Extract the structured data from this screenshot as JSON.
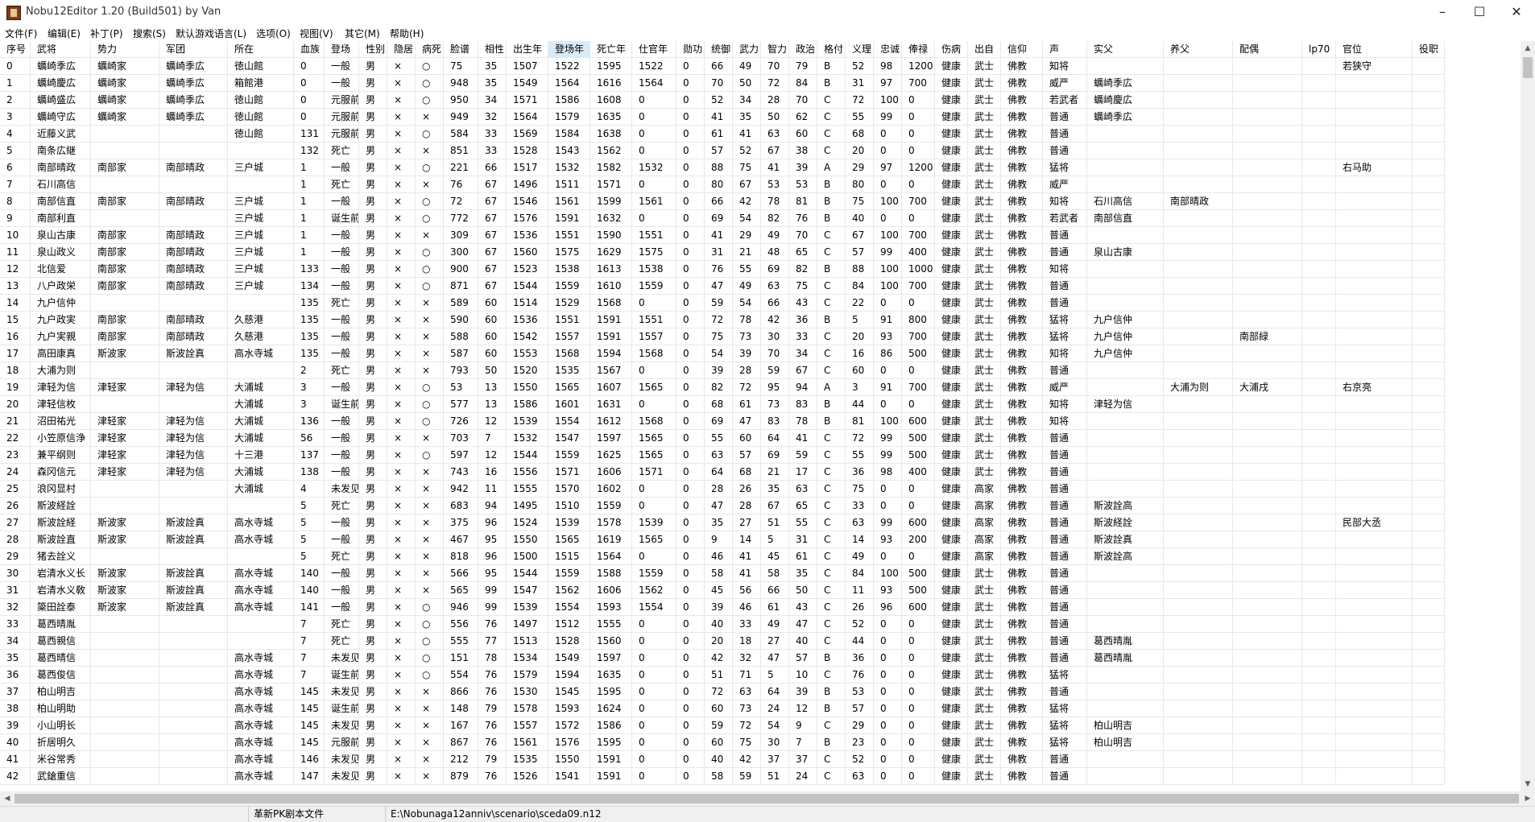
{
  "window": {
    "title": "Nobu12Editor 1.20 (Build501) by Van",
    "minimize_icon": "–",
    "maximize_icon": "☐",
    "close_icon": "✕"
  },
  "menu": [
    "文件(F)",
    "编辑(E)",
    "补丁(P)",
    "搜索(S)",
    "默认游戏语言(L)",
    "选项(O)",
    "视图(V)",
    "其它(M)",
    "帮助(H)"
  ],
  "columns": [
    "序号",
    "武将",
    "势力",
    "军团",
    "所在",
    "血族",
    "登场",
    "性别",
    "隐居",
    "病死",
    "脸谱",
    "相性",
    "出生年",
    "登场年",
    "死亡年",
    "仕官年",
    "勋功",
    "统御",
    "武力",
    "智力",
    "政治",
    "格付",
    "义理",
    "忠诚",
    "俸禄",
    "伤病",
    "出自",
    "信仰",
    "声",
    "实父",
    "养父",
    "配偶",
    "lp70",
    "官位",
    "役职"
  ],
  "sorted_column": 13,
  "rows": [
    [
      "0",
      "蠣崎季広",
      "蠣崎家",
      "蠣崎季広",
      "徳山館",
      "0",
      "一般",
      "男",
      "×",
      "○",
      "75",
      "35",
      "1507",
      "1522",
      "1595",
      "1522",
      "0",
      "66",
      "49",
      "70",
      "79",
      "B",
      "52",
      "98",
      "1200",
      "健康",
      "武士",
      "佛教",
      "知将",
      "",
      "",
      "",
      "",
      "若狭守",
      ""
    ],
    [
      "1",
      "蠣崎慶広",
      "蠣崎家",
      "蠣崎季広",
      "箱館港",
      "0",
      "一般",
      "男",
      "×",
      "○",
      "948",
      "35",
      "1549",
      "1564",
      "1616",
      "1564",
      "0",
      "70",
      "50",
      "72",
      "84",
      "B",
      "31",
      "97",
      "700",
      "健康",
      "武士",
      "佛教",
      "威严",
      "蠣崎季広",
      "",
      "",
      "",
      "",
      ""
    ],
    [
      "2",
      "蠣崎盛広",
      "蠣崎家",
      "蠣崎季広",
      "徳山館",
      "0",
      "元服前",
      "男",
      "×",
      "○",
      "950",
      "34",
      "1571",
      "1586",
      "1608",
      "0",
      "0",
      "52",
      "34",
      "28",
      "70",
      "C",
      "72",
      "100",
      "0",
      "健康",
      "武士",
      "佛教",
      "若武者",
      "蠣崎慶広",
      "",
      "",
      "",
      "",
      ""
    ],
    [
      "3",
      "蠣崎守広",
      "蠣崎家",
      "蠣崎季広",
      "徳山館",
      "0",
      "元服前",
      "男",
      "×",
      "×",
      "949",
      "32",
      "1564",
      "1579",
      "1635",
      "0",
      "0",
      "41",
      "35",
      "50",
      "62",
      "C",
      "55",
      "99",
      "0",
      "健康",
      "武士",
      "佛教",
      "普通",
      "蠣崎季広",
      "",
      "",
      "",
      "",
      ""
    ],
    [
      "4",
      "近藤义武",
      "",
      "",
      "徳山館",
      "131",
      "元服前",
      "男",
      "×",
      "○",
      "584",
      "33",
      "1569",
      "1584",
      "1638",
      "0",
      "0",
      "61",
      "41",
      "63",
      "60",
      "C",
      "68",
      "0",
      "0",
      "健康",
      "武士",
      "佛教",
      "普通",
      "",
      "",
      "",
      "",
      "",
      ""
    ],
    [
      "5",
      "南条広継",
      "",
      "",
      "",
      "132",
      "死亡",
      "男",
      "×",
      "×",
      "851",
      "33",
      "1528",
      "1543",
      "1562",
      "0",
      "0",
      "57",
      "52",
      "67",
      "38",
      "C",
      "20",
      "0",
      "0",
      "健康",
      "武士",
      "佛教",
      "普通",
      "",
      "",
      "",
      "",
      "",
      ""
    ],
    [
      "6",
      "南部晴政",
      "南部家",
      "南部晴政",
      "三户城",
      "1",
      "一般",
      "男",
      "×",
      "○",
      "221",
      "66",
      "1517",
      "1532",
      "1582",
      "1532",
      "0",
      "88",
      "75",
      "41",
      "39",
      "A",
      "29",
      "97",
      "1200",
      "健康",
      "武士",
      "佛教",
      "猛将",
      "",
      "",
      "",
      "",
      "右马助",
      ""
    ],
    [
      "7",
      "石川高信",
      "",
      "",
      "",
      "1",
      "死亡",
      "男",
      "×",
      "×",
      "76",
      "67",
      "1496",
      "1511",
      "1571",
      "0",
      "0",
      "80",
      "67",
      "53",
      "53",
      "B",
      "80",
      "0",
      "0",
      "健康",
      "武士",
      "佛教",
      "威严",
      "",
      "",
      "",
      "",
      "",
      ""
    ],
    [
      "8",
      "南部信直",
      "南部家",
      "南部晴政",
      "三户城",
      "1",
      "一般",
      "男",
      "×",
      "○",
      "72",
      "67",
      "1546",
      "1561",
      "1599",
      "1561",
      "0",
      "66",
      "42",
      "78",
      "81",
      "B",
      "75",
      "100",
      "700",
      "健康",
      "武士",
      "佛教",
      "知将",
      "石川高信",
      "南部晴政",
      "",
      "",
      "",
      ""
    ],
    [
      "9",
      "南部利直",
      "",
      "",
      "三户城",
      "1",
      "诞生前",
      "男",
      "×",
      "○",
      "772",
      "67",
      "1576",
      "1591",
      "1632",
      "0",
      "0",
      "69",
      "54",
      "82",
      "76",
      "B",
      "40",
      "0",
      "0",
      "健康",
      "武士",
      "佛教",
      "若武者",
      "南部信直",
      "",
      "",
      "",
      "",
      ""
    ],
    [
      "10",
      "泉山古康",
      "南部家",
      "南部晴政",
      "三户城",
      "1",
      "一般",
      "男",
      "×",
      "×",
      "309",
      "67",
      "1536",
      "1551",
      "1590",
      "1551",
      "0",
      "41",
      "29",
      "49",
      "70",
      "C",
      "67",
      "100",
      "700",
      "健康",
      "武士",
      "佛教",
      "普通",
      "",
      "",
      "",
      "",
      "",
      ""
    ],
    [
      "11",
      "泉山政义",
      "南部家",
      "南部晴政",
      "三户城",
      "1",
      "一般",
      "男",
      "×",
      "○",
      "300",
      "67",
      "1560",
      "1575",
      "1629",
      "1575",
      "0",
      "31",
      "21",
      "48",
      "65",
      "C",
      "57",
      "99",
      "400",
      "健康",
      "武士",
      "佛教",
      "普通",
      "泉山古康",
      "",
      "",
      "",
      "",
      ""
    ],
    [
      "12",
      "北信爱",
      "南部家",
      "南部晴政",
      "三户城",
      "133",
      "一般",
      "男",
      "×",
      "○",
      "900",
      "67",
      "1523",
      "1538",
      "1613",
      "1538",
      "0",
      "76",
      "55",
      "69",
      "82",
      "B",
      "88",
      "100",
      "1000",
      "健康",
      "武士",
      "佛教",
      "知将",
      "",
      "",
      "",
      "",
      "",
      ""
    ],
    [
      "13",
      "八户政栄",
      "南部家",
      "南部晴政",
      "三户城",
      "134",
      "一般",
      "男",
      "×",
      "○",
      "871",
      "67",
      "1544",
      "1559",
      "1610",
      "1559",
      "0",
      "47",
      "49",
      "63",
      "75",
      "C",
      "84",
      "100",
      "700",
      "健康",
      "武士",
      "佛教",
      "普通",
      "",
      "",
      "",
      "",
      "",
      ""
    ],
    [
      "14",
      "九户信仲",
      "",
      "",
      "",
      "135",
      "死亡",
      "男",
      "×",
      "×",
      "589",
      "60",
      "1514",
      "1529",
      "1568",
      "0",
      "0",
      "59",
      "54",
      "66",
      "43",
      "C",
      "22",
      "0",
      "0",
      "健康",
      "武士",
      "佛教",
      "普通",
      "",
      "",
      "",
      "",
      "",
      ""
    ],
    [
      "15",
      "九户政実",
      "南部家",
      "南部晴政",
      "久慈港",
      "135",
      "一般",
      "男",
      "×",
      "×",
      "590",
      "60",
      "1536",
      "1551",
      "1591",
      "1551",
      "0",
      "72",
      "78",
      "42",
      "36",
      "B",
      "5",
      "91",
      "800",
      "健康",
      "武士",
      "佛教",
      "猛将",
      "九户信仲",
      "",
      "",
      "",
      "",
      ""
    ],
    [
      "16",
      "九户実親",
      "南部家",
      "南部晴政",
      "久慈港",
      "135",
      "一般",
      "男",
      "×",
      "×",
      "588",
      "60",
      "1542",
      "1557",
      "1591",
      "1557",
      "0",
      "75",
      "73",
      "30",
      "33",
      "C",
      "20",
      "93",
      "700",
      "健康",
      "武士",
      "佛教",
      "猛将",
      "九户信仲",
      "",
      "南部緑",
      "",
      "",
      ""
    ],
    [
      "17",
      "高田康真",
      "斯波家",
      "斯波詮真",
      "高水寺城",
      "135",
      "一般",
      "男",
      "×",
      "×",
      "587",
      "60",
      "1553",
      "1568",
      "1594",
      "1568",
      "0",
      "54",
      "39",
      "70",
      "34",
      "C",
      "16",
      "86",
      "500",
      "健康",
      "武士",
      "佛教",
      "知将",
      "九户信仲",
      "",
      "",
      "",
      "",
      ""
    ],
    [
      "18",
      "大浦为则",
      "",
      "",
      "",
      "2",
      "死亡",
      "男",
      "×",
      "×",
      "793",
      "50",
      "1520",
      "1535",
      "1567",
      "0",
      "0",
      "39",
      "28",
      "59",
      "67",
      "C",
      "60",
      "0",
      "0",
      "健康",
      "武士",
      "佛教",
      "普通",
      "",
      "",
      "",
      "",
      "",
      ""
    ],
    [
      "19",
      "津轻为信",
      "津轻家",
      "津轻为信",
      "大浦城",
      "3",
      "一般",
      "男",
      "×",
      "○",
      "53",
      "13",
      "1550",
      "1565",
      "1607",
      "1565",
      "0",
      "82",
      "72",
      "95",
      "94",
      "A",
      "3",
      "91",
      "700",
      "健康",
      "武士",
      "佛教",
      "威严",
      "",
      "大浦为则",
      "大浦戌",
      "",
      "右京亮",
      ""
    ],
    [
      "20",
      "津轻信枚",
      "",
      "",
      "大浦城",
      "3",
      "诞生前",
      "男",
      "×",
      "○",
      "577",
      "13",
      "1586",
      "1601",
      "1631",
      "0",
      "0",
      "68",
      "61",
      "73",
      "83",
      "B",
      "44",
      "0",
      "0",
      "健康",
      "武士",
      "佛教",
      "知将",
      "津轻为信",
      "",
      "",
      "",
      "",
      ""
    ],
    [
      "21",
      "沼田祐光",
      "津轻家",
      "津轻为信",
      "大浦城",
      "136",
      "一般",
      "男",
      "×",
      "○",
      "726",
      "12",
      "1539",
      "1554",
      "1612",
      "1568",
      "0",
      "69",
      "47",
      "83",
      "78",
      "B",
      "81",
      "100",
      "600",
      "健康",
      "武士",
      "佛教",
      "知将",
      "",
      "",
      "",
      "",
      "",
      ""
    ],
    [
      "22",
      "小笠原信浄",
      "津轻家",
      "津轻为信",
      "大浦城",
      "56",
      "一般",
      "男",
      "×",
      "×",
      "703",
      "7",
      "1532",
      "1547",
      "1597",
      "1565",
      "0",
      "55",
      "60",
      "64",
      "41",
      "C",
      "72",
      "99",
      "500",
      "健康",
      "武士",
      "佛教",
      "普通",
      "",
      "",
      "",
      "",
      "",
      ""
    ],
    [
      "23",
      "兼平纲则",
      "津轻家",
      "津轻为信",
      "十三港",
      "137",
      "一般",
      "男",
      "×",
      "○",
      "597",
      "12",
      "1544",
      "1559",
      "1625",
      "1565",
      "0",
      "63",
      "57",
      "69",
      "59",
      "C",
      "55",
      "99",
      "500",
      "健康",
      "武士",
      "佛教",
      "普通",
      "",
      "",
      "",
      "",
      "",
      ""
    ],
    [
      "24",
      "森冈信元",
      "津轻家",
      "津轻为信",
      "大浦城",
      "138",
      "一般",
      "男",
      "×",
      "×",
      "743",
      "16",
      "1556",
      "1571",
      "1606",
      "1571",
      "0",
      "64",
      "68",
      "21",
      "17",
      "C",
      "36",
      "98",
      "400",
      "健康",
      "武士",
      "佛教",
      "普通",
      "",
      "",
      "",
      "",
      "",
      ""
    ],
    [
      "25",
      "浪冈显村",
      "",
      "",
      "大浦城",
      "4",
      "未发见",
      "男",
      "×",
      "×",
      "942",
      "11",
      "1555",
      "1570",
      "1602",
      "0",
      "0",
      "28",
      "26",
      "35",
      "63",
      "C",
      "75",
      "0",
      "0",
      "健康",
      "高家",
      "佛教",
      "普通",
      "",
      "",
      "",
      "",
      "",
      ""
    ],
    [
      "26",
      "斯波経詮",
      "",
      "",
      "",
      "5",
      "死亡",
      "男",
      "×",
      "×",
      "683",
      "94",
      "1495",
      "1510",
      "1559",
      "0",
      "0",
      "47",
      "28",
      "67",
      "65",
      "C",
      "33",
      "0",
      "0",
      "健康",
      "高家",
      "佛教",
      "普通",
      "斯波詮高",
      "",
      "",
      "",
      "",
      ""
    ],
    [
      "27",
      "斯波詮経",
      "斯波家",
      "斯波詮真",
      "高水寺城",
      "5",
      "一般",
      "男",
      "×",
      "×",
      "375",
      "96",
      "1524",
      "1539",
      "1578",
      "1539",
      "0",
      "35",
      "27",
      "51",
      "55",
      "C",
      "63",
      "99",
      "600",
      "健康",
      "高家",
      "佛教",
      "普通",
      "斯波経詮",
      "",
      "",
      "",
      "民部大丞",
      ""
    ],
    [
      "28",
      "斯波詮直",
      "斯波家",
      "斯波詮真",
      "高水寺城",
      "5",
      "一般",
      "男",
      "×",
      "×",
      "467",
      "95",
      "1550",
      "1565",
      "1619",
      "1565",
      "0",
      "9",
      "14",
      "5",
      "31",
      "C",
      "14",
      "93",
      "200",
      "健康",
      "高家",
      "佛教",
      "普通",
      "斯波詮真",
      "",
      "",
      "",
      "",
      ""
    ],
    [
      "29",
      "猪去詮义",
      "",
      "",
      "",
      "5",
      "死亡",
      "男",
      "×",
      "×",
      "818",
      "96",
      "1500",
      "1515",
      "1564",
      "0",
      "0",
      "46",
      "41",
      "45",
      "61",
      "C",
      "49",
      "0",
      "0",
      "健康",
      "高家",
      "佛教",
      "普通",
      "斯波詮高",
      "",
      "",
      "",
      "",
      ""
    ],
    [
      "30",
      "岩清水义长",
      "斯波家",
      "斯波詮真",
      "高水寺城",
      "140",
      "一般",
      "男",
      "×",
      "×",
      "566",
      "95",
      "1544",
      "1559",
      "1588",
      "1559",
      "0",
      "58",
      "41",
      "58",
      "35",
      "C",
      "84",
      "100",
      "500",
      "健康",
      "武士",
      "佛教",
      "普通",
      "",
      "",
      "",
      "",
      "",
      ""
    ],
    [
      "31",
      "岩清水义敎",
      "斯波家",
      "斯波詮真",
      "高水寺城",
      "140",
      "一般",
      "男",
      "×",
      "×",
      "565",
      "99",
      "1547",
      "1562",
      "1606",
      "1562",
      "0",
      "45",
      "56",
      "66",
      "50",
      "C",
      "11",
      "93",
      "500",
      "健康",
      "武士",
      "佛教",
      "普通",
      "",
      "",
      "",
      "",
      "",
      ""
    ],
    [
      "32",
      "簗田詮泰",
      "斯波家",
      "斯波詮真",
      "高水寺城",
      "141",
      "一般",
      "男",
      "×",
      "○",
      "946",
      "99",
      "1539",
      "1554",
      "1593",
      "1554",
      "0",
      "39",
      "46",
      "61",
      "43",
      "C",
      "26",
      "96",
      "600",
      "健康",
      "武士",
      "佛教",
      "普通",
      "",
      "",
      "",
      "",
      "",
      ""
    ],
    [
      "33",
      "葛西晴胤",
      "",
      "",
      "",
      "7",
      "死亡",
      "男",
      "×",
      "○",
      "556",
      "76",
      "1497",
      "1512",
      "1555",
      "0",
      "0",
      "40",
      "33",
      "49",
      "47",
      "C",
      "52",
      "0",
      "0",
      "健康",
      "武士",
      "佛教",
      "普通",
      "",
      "",
      "",
      "",
      "",
      ""
    ],
    [
      "34",
      "葛西親信",
      "",
      "",
      "",
      "7",
      "死亡",
      "男",
      "×",
      "○",
      "555",
      "77",
      "1513",
      "1528",
      "1560",
      "0",
      "0",
      "20",
      "18",
      "27",
      "40",
      "C",
      "44",
      "0",
      "0",
      "健康",
      "武士",
      "佛教",
      "普通",
      "葛西晴胤",
      "",
      "",
      "",
      "",
      ""
    ],
    [
      "35",
      "葛西晴信",
      "",
      "",
      "高水寺城",
      "7",
      "未发见",
      "男",
      "×",
      "○",
      "151",
      "78",
      "1534",
      "1549",
      "1597",
      "0",
      "0",
      "42",
      "32",
      "47",
      "57",
      "B",
      "36",
      "0",
      "0",
      "健康",
      "武士",
      "佛教",
      "普通",
      "葛西晴胤",
      "",
      "",
      "",
      "",
      ""
    ],
    [
      "36",
      "葛西俊信",
      "",
      "",
      "高水寺城",
      "7",
      "诞生前",
      "男",
      "×",
      "○",
      "554",
      "76",
      "1579",
      "1594",
      "1635",
      "0",
      "0",
      "51",
      "71",
      "5",
      "10",
      "C",
      "76",
      "0",
      "0",
      "健康",
      "武士",
      "佛教",
      "猛将",
      "",
      "",
      "",
      "",
      "",
      ""
    ],
    [
      "37",
      "柏山明吉",
      "",
      "",
      "高水寺城",
      "145",
      "未发见",
      "男",
      "×",
      "×",
      "866",
      "76",
      "1530",
      "1545",
      "1595",
      "0",
      "0",
      "72",
      "63",
      "64",
      "39",
      "B",
      "53",
      "0",
      "0",
      "健康",
      "武士",
      "佛教",
      "普通",
      "",
      "",
      "",
      "",
      "",
      ""
    ],
    [
      "38",
      "柏山明助",
      "",
      "",
      "高水寺城",
      "145",
      "诞生前",
      "男",
      "×",
      "×",
      "148",
      "79",
      "1578",
      "1593",
      "1624",
      "0",
      "0",
      "60",
      "73",
      "24",
      "12",
      "B",
      "57",
      "0",
      "0",
      "健康",
      "武士",
      "佛教",
      "猛将",
      "",
      "",
      "",
      "",
      "",
      ""
    ],
    [
      "39",
      "小山明长",
      "",
      "",
      "高水寺城",
      "145",
      "未发见",
      "男",
      "×",
      "×",
      "167",
      "76",
      "1557",
      "1572",
      "1586",
      "0",
      "0",
      "59",
      "72",
      "54",
      "9",
      "C",
      "29",
      "0",
      "0",
      "健康",
      "武士",
      "佛教",
      "猛将",
      "柏山明吉",
      "",
      "",
      "",
      "",
      ""
    ],
    [
      "40",
      "折居明久",
      "",
      "",
      "高水寺城",
      "145",
      "元服前",
      "男",
      "×",
      "×",
      "867",
      "76",
      "1561",
      "1576",
      "1595",
      "0",
      "0",
      "60",
      "75",
      "30",
      "7",
      "B",
      "23",
      "0",
      "0",
      "健康",
      "武士",
      "佛教",
      "猛将",
      "柏山明吉",
      "",
      "",
      "",
      "",
      ""
    ],
    [
      "41",
      "米谷常秀",
      "",
      "",
      "高水寺城",
      "146",
      "未发见",
      "男",
      "×",
      "×",
      "212",
      "79",
      "1535",
      "1550",
      "1591",
      "0",
      "0",
      "40",
      "42",
      "37",
      "37",
      "C",
      "52",
      "0",
      "0",
      "健康",
      "武士",
      "佛教",
      "普通",
      "",
      "",
      "",
      "",
      "",
      ""
    ],
    [
      "42",
      "武鎗重信",
      "",
      "",
      "高水寺城",
      "147",
      "未发见",
      "男",
      "×",
      "×",
      "879",
      "76",
      "1526",
      "1541",
      "1591",
      "0",
      "0",
      "58",
      "59",
      "51",
      "24",
      "C",
      "63",
      "0",
      "0",
      "健康",
      "武士",
      "佛教",
      "普通",
      "",
      "",
      "",
      "",
      "",
      ""
    ]
  ],
  "status": {
    "action": "革新PK剧本文件",
    "path": "E:\\Nobunaga12anniv\\scenario\\sceda09.n12"
  }
}
